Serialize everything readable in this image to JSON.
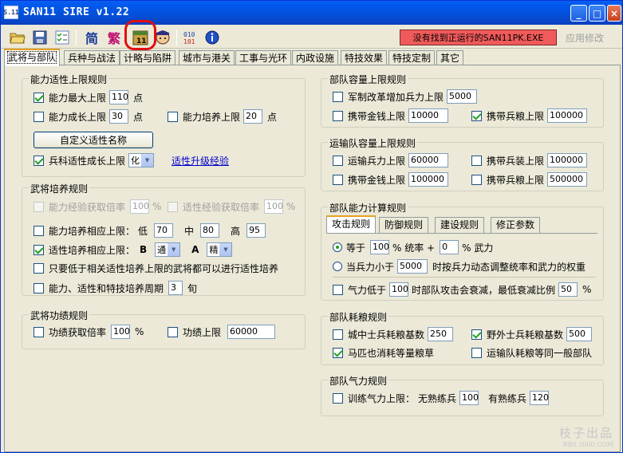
{
  "window": {
    "title": "SAN11 SIRE v1.22",
    "icon_text": "S.11"
  },
  "toolbar": {
    "simplified_label": "简",
    "traditional_label": "繁",
    "status_text": "没有找到正运行的SAN11PK.EXE",
    "apply_label": "应用修改"
  },
  "tabs": [
    "武将与部队",
    "兵种与战法",
    "计略与陷阱",
    "城市与港关",
    "工事与光环",
    "内政设施",
    "特技效果",
    "特技定制",
    "其它"
  ],
  "ability_limits": {
    "title": "能力适性上限规则",
    "max_label": "能力最大上限",
    "max_value": "110",
    "max_unit": "点",
    "growth_label": "能力成长上限",
    "growth_value": "30",
    "growth_unit": "点",
    "train_label": "能力培养上限",
    "train_value": "20",
    "train_unit": "点",
    "custom_name_button": "自定义适性名称",
    "aptitude_growth_label": "兵科适性成长上限",
    "aptitude_growth_value": "化",
    "aptitude_link": "适性升级经验"
  },
  "general_training": {
    "title": "武将培养规则",
    "exp_ability_label": "能力经验获取倍率",
    "exp_ability_value": "100",
    "percent": "%",
    "exp_aptitude_label": "适性经验获取倍率",
    "exp_aptitude_value": "100",
    "ability_train_label": "能力培养相应上限：",
    "low_label": "低",
    "low_value": "70",
    "mid_label": "中",
    "mid_value": "80",
    "high_label": "高",
    "high_value": "95",
    "aptitude_train_label": "适性培养相应上限：",
    "b_label": "B",
    "b_value": "通",
    "a_label": "A",
    "a_value": "精",
    "only_lower_label": "只要低于相关适性培养上限的武将都可以进行适性培养",
    "cycle_label": "能力、适性和特技培养周期",
    "cycle_value": "3",
    "cycle_unit": "旬"
  },
  "merit": {
    "title": "武将功绩规则",
    "rate_label": "功绩获取倍率",
    "rate_value": "100",
    "percent": "%",
    "limit_label": "功绩上限",
    "limit_value": "60000"
  },
  "unit_capacity": {
    "title": "部队容量上限规则",
    "military_reform_label": "军制改革增加兵力上限",
    "military_reform_value": "5000",
    "gold_label": "携带金钱上限",
    "gold_value": "10000",
    "food_label": "携带兵粮上限",
    "food_value": "100000"
  },
  "transport_capacity": {
    "title": "运输队容量上限规则",
    "troops_label": "运输兵力上限",
    "troops_value": "60000",
    "equip_label": "携带兵装上限",
    "equip_value": "100000",
    "gold_label": "携带金钱上限",
    "gold_value": "100000",
    "food_label": "携带兵粮上限",
    "food_value": "500000"
  },
  "unit_ability_calc": {
    "title": "部队能力计算规则",
    "subtabs": [
      "攻击规则",
      "防御规则",
      "建设规则",
      "修正参数"
    ],
    "equal_label": "等于",
    "lead_value": "100",
    "lead_text": "% 统率 +",
    "war_value": "0",
    "war_text": "% 武力",
    "troops_lt_label": "当兵力小于",
    "troops_lt_value": "5000",
    "troops_lt_text": "时按兵力动态调整统率和武力的权重",
    "morale_label": "气力低于",
    "morale_value": "100",
    "morale_text": "时部队攻击会衰减，最低衰减比例",
    "decay_value": "50",
    "percent": "%"
  },
  "food_consumption": {
    "title": "部队耗粮规则",
    "city_label": "城中士兵耗粮基数",
    "city_value": "250",
    "field_label": "野外士兵耗粮基数",
    "field_value": "500",
    "horse_label": "马匹也消耗等量粮草",
    "transport_label": "运输队耗粮等同一般部队"
  },
  "morale_rules": {
    "title": "部队气力规则",
    "train_label": "训练气力上限：",
    "no_skill_label": "无熟练兵",
    "no_skill_value": "100",
    "skill_label": "有熟练兵",
    "skill_value": "120"
  },
  "watermark": {
    "line1": "枝子出品",
    "line2": "BBS.3000.COM"
  }
}
